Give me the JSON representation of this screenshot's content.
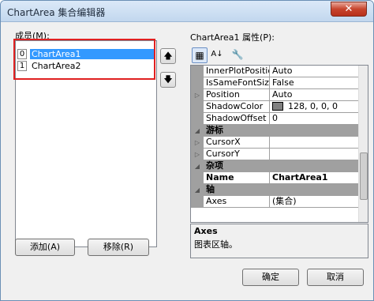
{
  "window": {
    "title": "ChartArea 集合编辑器",
    "close_symbol": "✕"
  },
  "members": {
    "label": "成员(M):",
    "items": [
      {
        "index": "0",
        "name": "ChartArea1",
        "selected": true
      },
      {
        "index": "1",
        "name": "ChartArea2",
        "selected": false
      }
    ],
    "up_symbol": "🡅",
    "down_symbol": "🡇"
  },
  "buttons": {
    "add": "添加(A)",
    "remove": "移除(R)",
    "ok": "确定",
    "cancel": "取消"
  },
  "properties": {
    "label": "ChartArea1 属性(P):",
    "toolbar": {
      "categorized": "▦",
      "alphabetical": "A↓",
      "pages": "🔧"
    },
    "rows": [
      {
        "type": "prop",
        "expand": "",
        "name": "InnerPlotPosition",
        "value": "Auto"
      },
      {
        "type": "prop",
        "expand": "",
        "name": "IsSameFontSizeFo",
        "value": "False"
      },
      {
        "type": "prop",
        "expand": "▷",
        "name": "Position",
        "value": "Auto"
      },
      {
        "type": "prop",
        "expand": "",
        "name": "ShadowColor",
        "value": "128, 0, 0, 0",
        "swatch": "#808080"
      },
      {
        "type": "prop",
        "expand": "",
        "name": "ShadowOffset",
        "value": "0"
      },
      {
        "type": "cat",
        "expand": "◢",
        "name": "游标",
        "value": ""
      },
      {
        "type": "prop",
        "expand": "▷",
        "name": "CursorX",
        "value": ""
      },
      {
        "type": "prop",
        "expand": "▷",
        "name": "CursorY",
        "value": ""
      },
      {
        "type": "cat",
        "expand": "◢",
        "name": "杂项",
        "value": ""
      },
      {
        "type": "prop",
        "expand": "",
        "name": "Name",
        "value": "ChartArea1",
        "bold": true
      },
      {
        "type": "cat",
        "expand": "◢",
        "name": "轴",
        "value": ""
      },
      {
        "type": "prop",
        "expand": "",
        "name": "Axes",
        "value": "(集合)"
      }
    ],
    "help": {
      "title": "Axes",
      "description": "图表区轴。"
    }
  }
}
